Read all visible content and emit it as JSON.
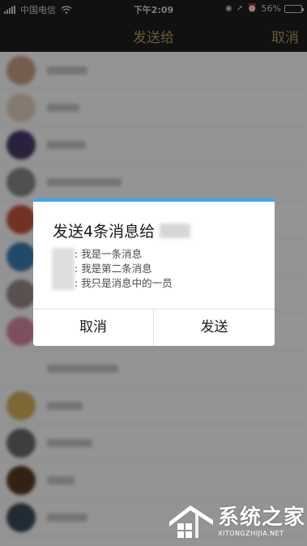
{
  "status_bar": {
    "carrier": "中国电信",
    "time": "下午2:09",
    "battery": "56%",
    "battery_level": 0.56
  },
  "nav": {
    "title": "发送给",
    "cancel": "取消"
  },
  "contacts": [
    {
      "avatar_color": "#c9a184"
    },
    {
      "avatar_color": "#e6d3c2"
    },
    {
      "avatar_color": "#4a3a6b"
    },
    {
      "avatar_color": "#8a8a8a"
    },
    {
      "avatar_color": "#c8553d"
    },
    {
      "avatar_color": "#3a7fb5"
    },
    {
      "avatar_color": "#9a8a8a"
    },
    {
      "avatar_color": "#d98aa3"
    },
    {
      "avatar_color": "#ffffff"
    },
    {
      "avatar_color": "#d9b15a"
    },
    {
      "avatar_color": "#6b6b6b"
    },
    {
      "avatar_color": "#5a3a1e"
    },
    {
      "avatar_color": "#3a4a5a"
    }
  ],
  "dialog": {
    "title": "发送4条消息给",
    "messages": [
      ": 我是一条消息",
      ": 我是第二条消息",
      ": 我只是消息中的一员"
    ],
    "cancel_label": "取消",
    "send_label": "发送",
    "accent_color": "#3ba7f0"
  },
  "watermark": {
    "text": "系统之家",
    "sub": "XITONGZHIJIA.NET"
  }
}
